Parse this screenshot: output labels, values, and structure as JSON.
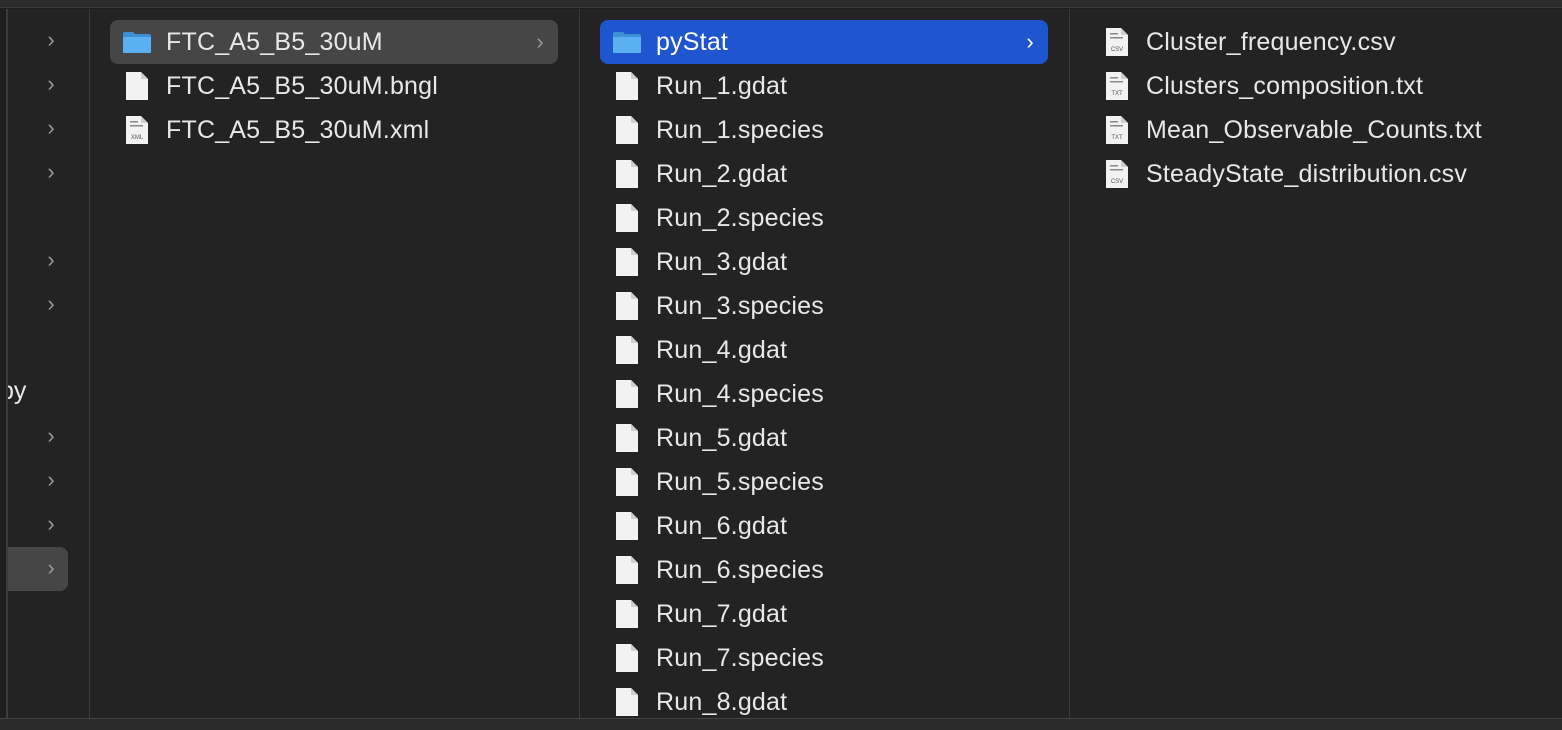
{
  "column0": {
    "partial_text": "py",
    "chevron_glyph": "›"
  },
  "column1": {
    "items": [
      {
        "label": "FTC_A5_B5_30uM",
        "icon": "folder-icon",
        "has_children": true
      },
      {
        "label": "FTC_A5_B5_30uM.bngl",
        "icon": "file-icon"
      },
      {
        "label": "FTC_A5_B5_30uM.xml",
        "icon": "xml-file-icon",
        "icon_tag": "XML"
      }
    ]
  },
  "column2": {
    "items": [
      {
        "label": "pyStat",
        "icon": "folder-icon",
        "has_children": true
      },
      {
        "label": "Run_1.gdat",
        "icon": "file-icon"
      },
      {
        "label": "Run_1.species",
        "icon": "file-icon"
      },
      {
        "label": "Run_2.gdat",
        "icon": "file-icon"
      },
      {
        "label": "Run_2.species",
        "icon": "file-icon"
      },
      {
        "label": "Run_3.gdat",
        "icon": "file-icon"
      },
      {
        "label": "Run_3.species",
        "icon": "file-icon"
      },
      {
        "label": "Run_4.gdat",
        "icon": "file-icon"
      },
      {
        "label": "Run_4.species",
        "icon": "file-icon"
      },
      {
        "label": "Run_5.gdat",
        "icon": "file-icon"
      },
      {
        "label": "Run_5.species",
        "icon": "file-icon"
      },
      {
        "label": "Run_6.gdat",
        "icon": "file-icon"
      },
      {
        "label": "Run_6.species",
        "icon": "file-icon"
      },
      {
        "label": "Run_7.gdat",
        "icon": "file-icon"
      },
      {
        "label": "Run_7.species",
        "icon": "file-icon"
      },
      {
        "label": "Run_8.gdat",
        "icon": "file-icon"
      }
    ]
  },
  "column3": {
    "items": [
      {
        "label": "Cluster_frequency.csv",
        "icon": "csv-file-icon",
        "icon_tag": "CSV"
      },
      {
        "label": "Clusters_composition.txt",
        "icon": "txt-file-icon",
        "icon_tag": "TXT"
      },
      {
        "label": "Mean_Observable_Counts.txt",
        "icon": "txt-file-icon",
        "icon_tag": "TXT"
      },
      {
        "label": "SteadyState_distribution.csv",
        "icon": "csv-file-icon",
        "icon_tag": "CSV"
      }
    ]
  },
  "colors": {
    "background": "#1e1e1e",
    "column": "#232323",
    "selection_active": "#1f56cf",
    "selection_inactive": "#464646",
    "folder": "#5ab0f0",
    "text": "#e8e8e8"
  }
}
